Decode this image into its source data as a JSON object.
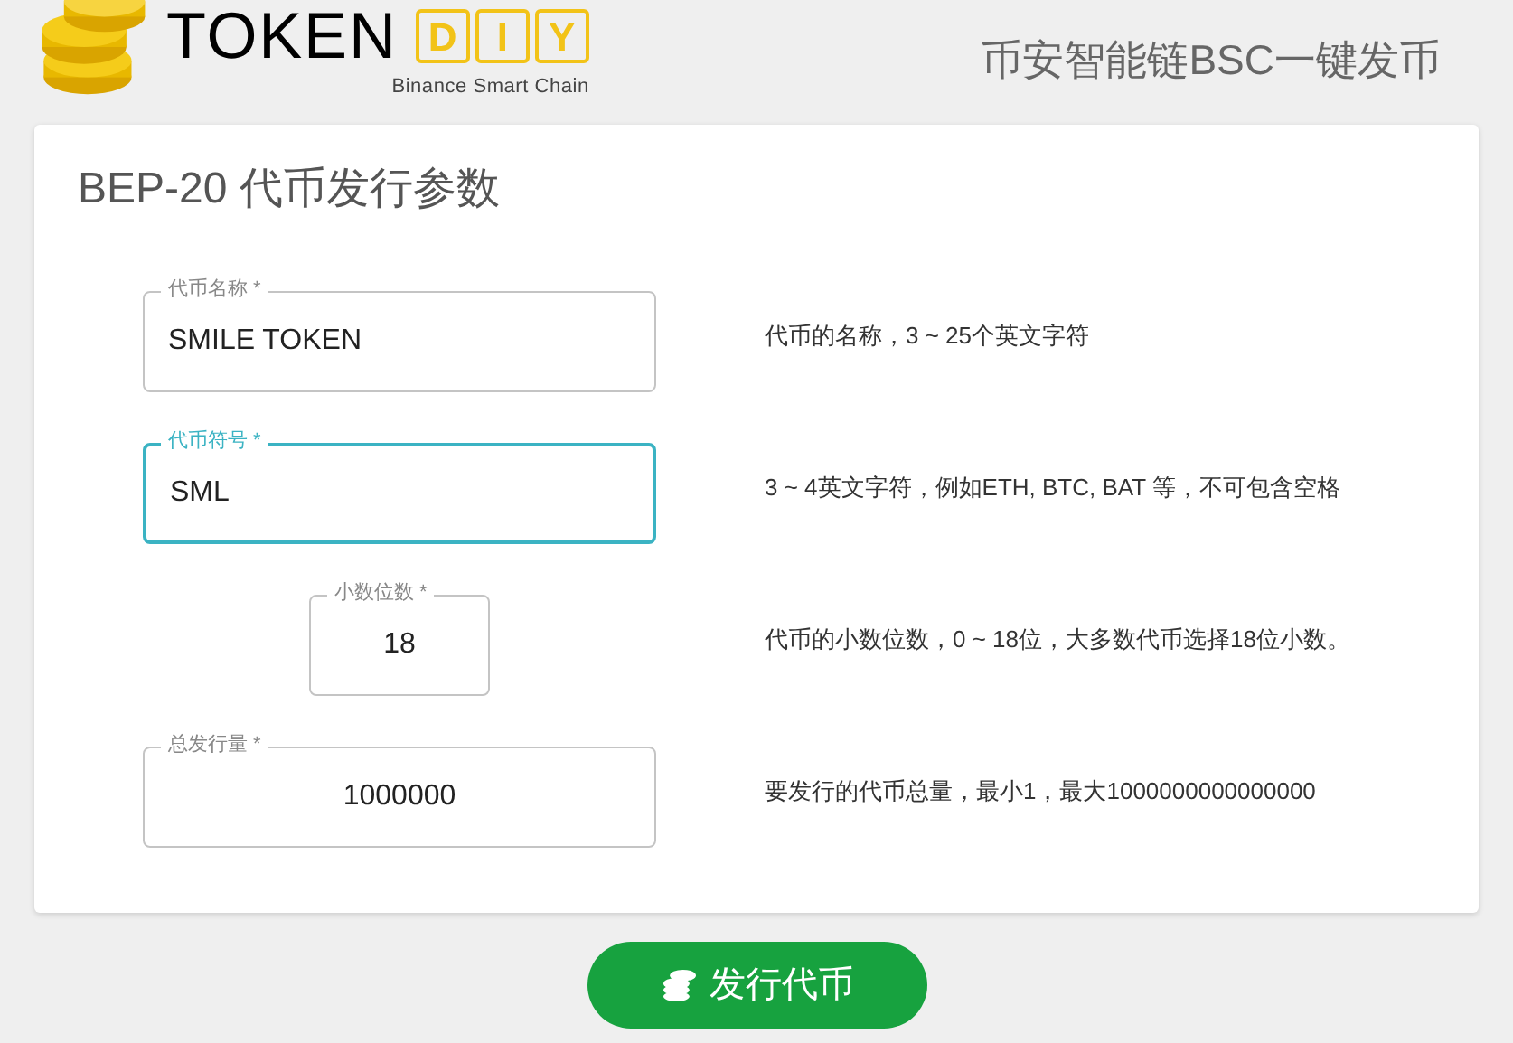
{
  "logo": {
    "word": "TOKEN",
    "letters": [
      "D",
      "I",
      "Y"
    ],
    "subtitle": "Binance Smart Chain"
  },
  "tagline": "币安智能链BSC一键发币",
  "form": {
    "title": "BEP-20 代币发行参数",
    "fields": [
      {
        "label": "代币名称 *",
        "value": "SMILE TOKEN",
        "kind": "wide-left",
        "focused": false,
        "hint": "代币的名称，3 ~ 25个英文字符"
      },
      {
        "label": "代币符号 *",
        "value": "SML",
        "kind": "wide-left",
        "focused": true,
        "hint": "3 ~ 4英文字符，例如ETH, BTC, BAT 等，不可包含空格"
      },
      {
        "label": "小数位数 *",
        "value": "18",
        "kind": "narrow-center",
        "focused": false,
        "hint": "代币的小数位数，0 ~ 18位，大多数代币选择18位小数。"
      },
      {
        "label": "总发行量 *",
        "value": "1000000",
        "kind": "wide-center",
        "focused": false,
        "hint": "要发行的代币总量，最小1，最大1000000000000000"
      }
    ]
  },
  "submit": {
    "label": "发行代币"
  }
}
